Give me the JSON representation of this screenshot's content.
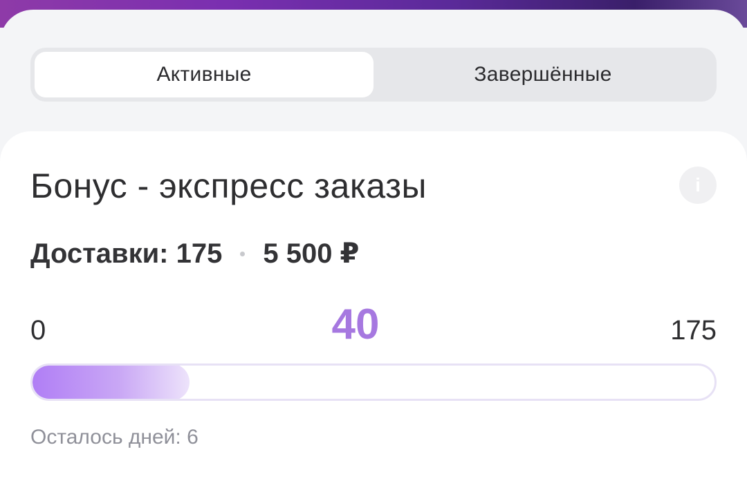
{
  "tabs": [
    {
      "label": "Активные",
      "active": true
    },
    {
      "label": "Завершённые",
      "active": false
    }
  ],
  "card": {
    "title": "Бонус - экспресс заказы",
    "info_icon": "info-icon",
    "deliveries_label": "Доставки: 175",
    "reward": "5 500 ₽",
    "progress": {
      "min": "0",
      "max": "175",
      "current": "40",
      "fraction": 0.2286
    },
    "days_left": "Осталось дней: 6"
  },
  "colors": {
    "accent": "#a678e0",
    "progress_start": "#b07ef5",
    "progress_end": "#ede3fb"
  }
}
